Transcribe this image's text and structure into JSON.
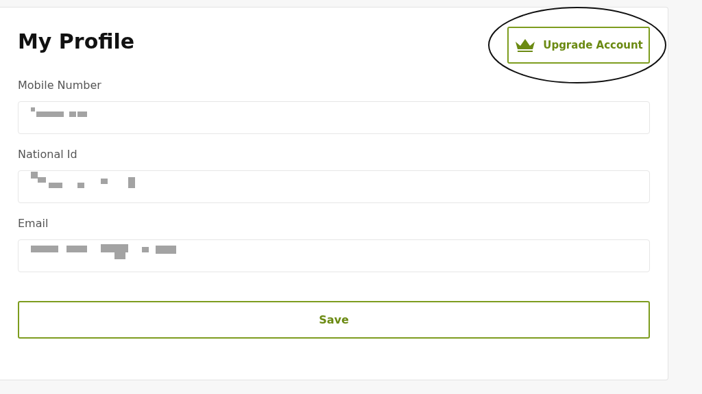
{
  "title": "My Profile",
  "upgrade_button": {
    "label": "Upgrade Account",
    "circled": true
  },
  "fields": [
    {
      "label": "Mobile Number",
      "redacted": true
    },
    {
      "label": "National Id",
      "redacted": true
    },
    {
      "label": "Email",
      "redacted": true
    }
  ],
  "save_button": {
    "label": "Save"
  }
}
